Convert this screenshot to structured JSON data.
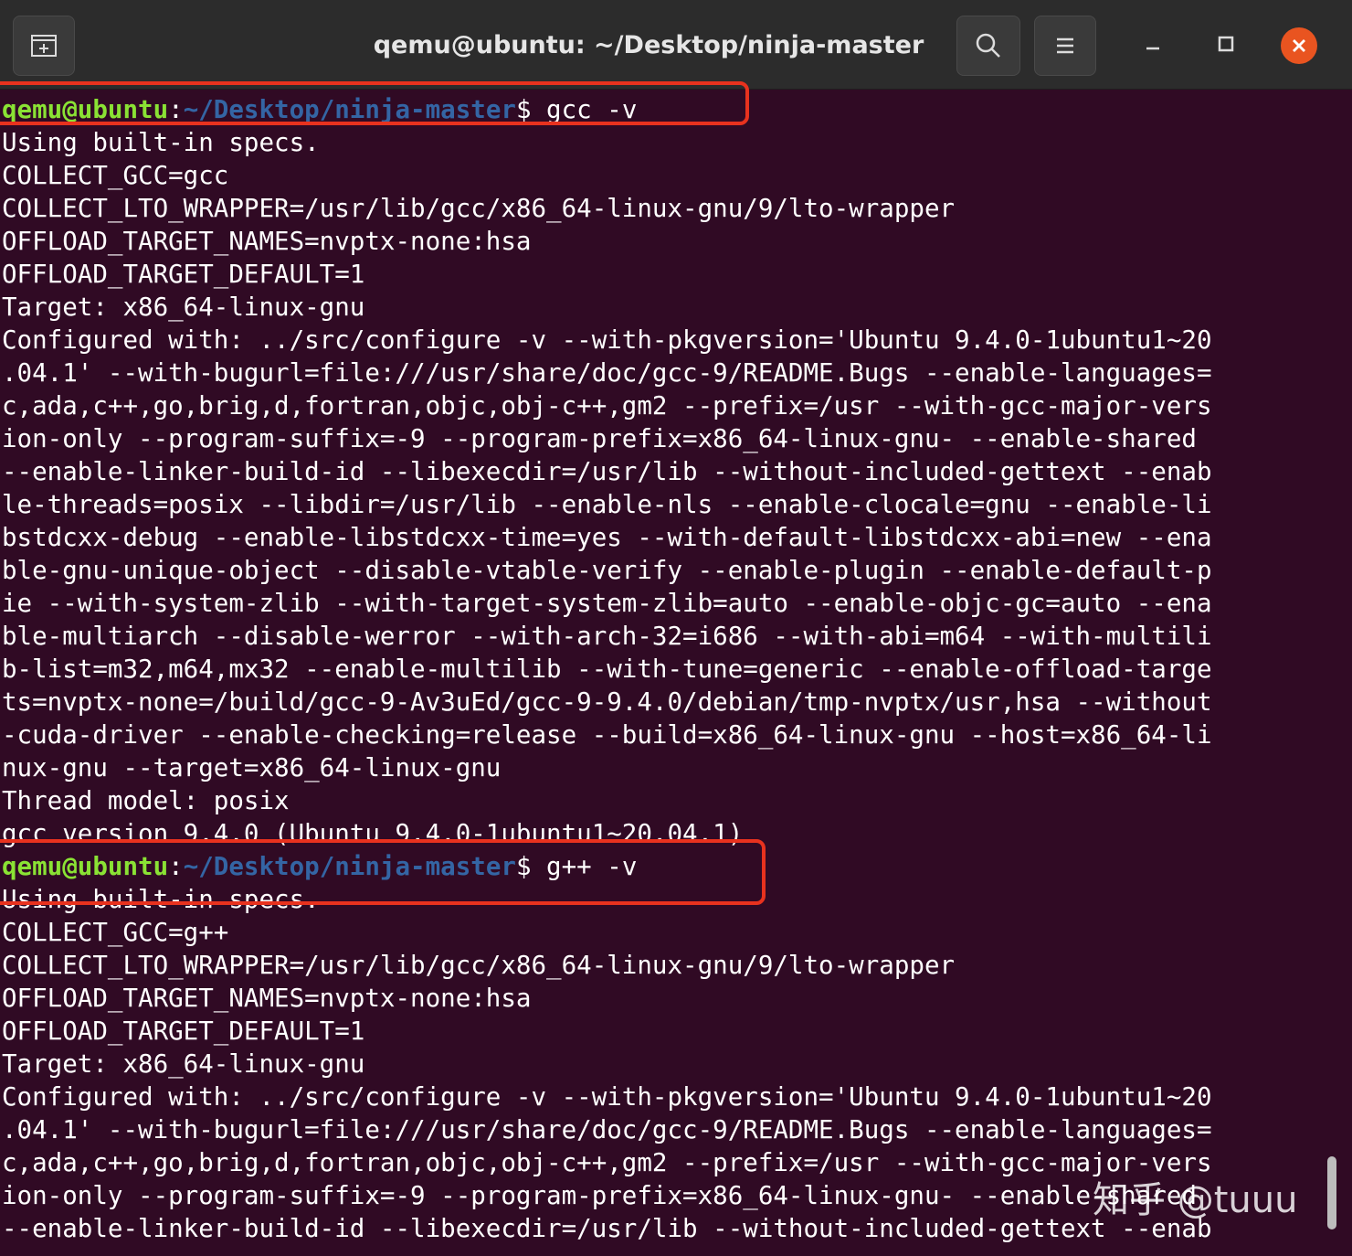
{
  "window": {
    "title": "qemu@ubuntu: ~/Desktop/ninja-master",
    "new_tab_icon": "new-tab-icon",
    "search_icon": "search-icon",
    "menu_icon": "hamburger-menu-icon",
    "minimize_icon": "minimize-icon",
    "maximize_icon": "maximize-icon",
    "close_icon": "close-icon",
    "close_color": "#e95420"
  },
  "colors": {
    "background": "#300a24",
    "prompt_user": "#8ae234",
    "prompt_path": "#3465a4",
    "highlight_box": "#e8321e"
  },
  "terminal": {
    "prompt1": {
      "user": "qemu@ubuntu",
      "sep": ":",
      "path": "~/Desktop/ninja-master",
      "command": "$ gcc -v"
    },
    "output1": [
      "Using built-in specs.",
      "COLLECT_GCC=gcc",
      "COLLECT_LTO_WRAPPER=/usr/lib/gcc/x86_64-linux-gnu/9/lto-wrapper",
      "OFFLOAD_TARGET_NAMES=nvptx-none:hsa",
      "OFFLOAD_TARGET_DEFAULT=1",
      "Target: x86_64-linux-gnu",
      "Configured with: ../src/configure -v --with-pkgversion='Ubuntu 9.4.0-1ubuntu1~20",
      ".04.1' --with-bugurl=file:///usr/share/doc/gcc-9/README.Bugs --enable-languages=",
      "c,ada,c++,go,brig,d,fortran,objc,obj-c++,gm2 --prefix=/usr --with-gcc-major-vers",
      "ion-only --program-suffix=-9 --program-prefix=x86_64-linux-gnu- --enable-shared",
      "--enable-linker-build-id --libexecdir=/usr/lib --without-included-gettext --enab",
      "le-threads=posix --libdir=/usr/lib --enable-nls --enable-clocale=gnu --enable-li",
      "bstdcxx-debug --enable-libstdcxx-time=yes --with-default-libstdcxx-abi=new --ena",
      "ble-gnu-unique-object --disable-vtable-verify --enable-plugin --enable-default-p",
      "ie --with-system-zlib --with-target-system-zlib=auto --enable-objc-gc=auto --ena",
      "ble-multiarch --disable-werror --with-arch-32=i686 --with-abi=m64 --with-multili",
      "b-list=m32,m64,mx32 --enable-multilib --with-tune=generic --enable-offload-targe",
      "ts=nvptx-none=/build/gcc-9-Av3uEd/gcc-9-9.4.0/debian/tmp-nvptx/usr,hsa --without",
      "-cuda-driver --enable-checking=release --build=x86_64-linux-gnu --host=x86_64-li",
      "nux-gnu --target=x86_64-linux-gnu",
      "Thread model: posix",
      "gcc version 9.4.0 (Ubuntu 9.4.0-1ubuntu1~20.04.1)"
    ],
    "prompt2": {
      "user": "qemu@ubuntu",
      "sep": ":",
      "path": "~/Desktop/ninja-master",
      "command": "$ g++ -v"
    },
    "output2": [
      "Using built-in specs.",
      "COLLECT_GCC=g++",
      "COLLECT_LTO_WRAPPER=/usr/lib/gcc/x86_64-linux-gnu/9/lto-wrapper",
      "OFFLOAD_TARGET_NAMES=nvptx-none:hsa",
      "OFFLOAD_TARGET_DEFAULT=1",
      "Target: x86_64-linux-gnu",
      "Configured with: ../src/configure -v --with-pkgversion='Ubuntu 9.4.0-1ubuntu1~20",
      ".04.1' --with-bugurl=file:///usr/share/doc/gcc-9/README.Bugs --enable-languages=",
      "c,ada,c++,go,brig,d,fortran,objc,obj-c++,gm2 --prefix=/usr --with-gcc-major-vers",
      "ion-only --program-suffix=-9 --program-prefix=x86_64-linux-gnu- --enable-shared",
      "--enable-linker-build-id --libexecdir=/usr/lib --without-included-gettext --enab"
    ]
  },
  "watermark": "知乎 @tuuu"
}
